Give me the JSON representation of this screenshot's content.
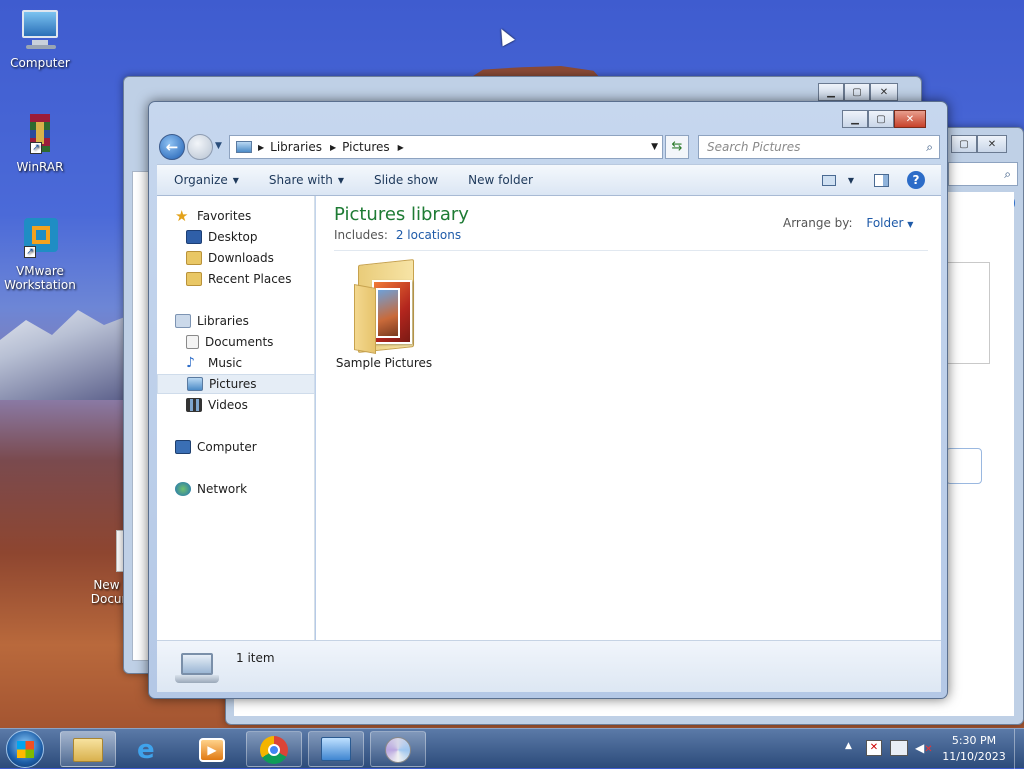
{
  "desktop": {
    "icons": [
      {
        "label": "Computer"
      },
      {
        "label": "WinRAR"
      },
      {
        "label_line1": "VMware",
        "label_line2": "Workstation"
      },
      {
        "label_line1": "New T",
        "label_line2": "Docum"
      }
    ]
  },
  "window": {
    "address": {
      "segments": [
        "Libraries",
        "Pictures"
      ]
    },
    "search_placeholder": "Search Pictures",
    "toolbar": {
      "organize": "Organize",
      "share_with": "Share with",
      "slide_show": "Slide show",
      "new_folder": "New folder"
    },
    "nav": {
      "favorites": "Favorites",
      "desktop": "Desktop",
      "downloads": "Downloads",
      "recent_places": "Recent Places",
      "libraries": "Libraries",
      "documents": "Documents",
      "music": "Music",
      "pictures": "Pictures",
      "videos": "Videos",
      "computer": "Computer",
      "network": "Network"
    },
    "content": {
      "title": "Pictures library",
      "includes_label": "Includes:",
      "includes_link": "2 locations",
      "arrange_label": "Arrange by:",
      "arrange_value": "Folder",
      "items": [
        {
          "label": "Sample Pictures"
        }
      ]
    },
    "status": {
      "count": "1 item"
    }
  },
  "taskbar": {
    "time": "5:30 PM",
    "date": "11/10/2023"
  },
  "colors": {
    "title_green": "#1e7b34",
    "link_blue": "#1e5aa8",
    "selected_row": "#e5edf6"
  }
}
